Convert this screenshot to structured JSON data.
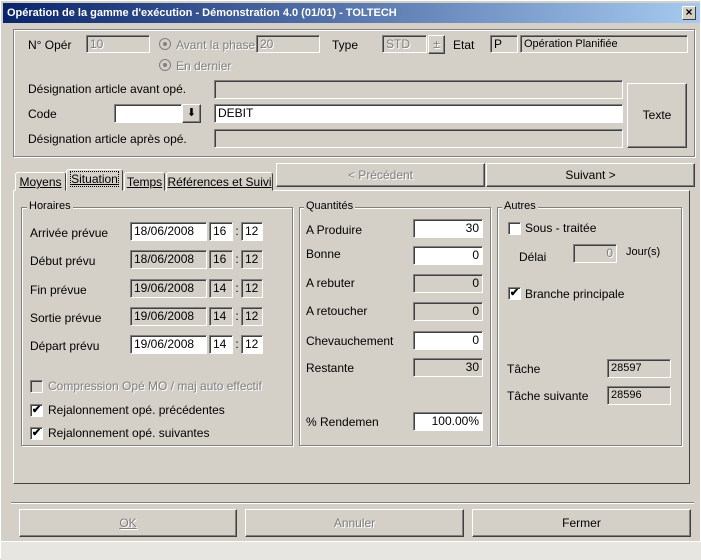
{
  "title": "Opération de la gamme d'exécution - Démonstration 4.0 (01/01) - TOLTECH",
  "header": {
    "no_oper_label": "N° Opér",
    "no_oper_value": "10",
    "radio_avant_label": "Avant la phase",
    "radio_avant_value": "20",
    "radio_dernier_label": "En dernier",
    "type_label": "Type",
    "type_value": "STD",
    "type_button": "±",
    "etat_label": "Etat",
    "etat_code": "P",
    "etat_value": "Opération Planifiée",
    "desig_avant_label": "Désignation article avant opé.",
    "desig_avant_value": "",
    "code_label": "Code",
    "code_value": "",
    "code_dropdown": "⬇",
    "code_desc": "DEBIT",
    "desig_apres_label": "Désignation article après opé.",
    "desig_apres_value": "",
    "texte_button": "Texte"
  },
  "tabs": [
    {
      "label": "Moyens",
      "accel": "M"
    },
    {
      "label": "Situation",
      "accel": "S"
    },
    {
      "label": "Temps",
      "accel": "T"
    },
    {
      "label": "Références et Suivi",
      "accel": "R"
    }
  ],
  "nav": {
    "prev": "< Précédent",
    "next": "Suivant >"
  },
  "horaires": {
    "legend": "Horaires",
    "rows": [
      {
        "label": "Arrivée prévue",
        "date": "18/06/2008",
        "hh": "16",
        "mm": "12",
        "editable": true
      },
      {
        "label": "Début prévu",
        "date": "18/06/2008",
        "hh": "16",
        "mm": "12",
        "editable": false
      },
      {
        "label": "Fin prévue",
        "date": "19/06/2008",
        "hh": "14",
        "mm": "12",
        "editable": false
      },
      {
        "label": "Sortie prévue",
        "date": "19/06/2008",
        "hh": "14",
        "mm": "12",
        "editable": false
      },
      {
        "label": "Départ prévu",
        "date": "19/06/2008",
        "hh": "14",
        "mm": "12",
        "editable": true
      }
    ],
    "colon": ":",
    "compression_label": "Compression Opé MO / maj auto effectif",
    "rejal_prec_label": "Rejalonnement opé. précédentes",
    "rejal_suiv_label": "Rejalonnement opé. suivantes",
    "check_mark": "✔"
  },
  "quantites": {
    "legend": "Quantités",
    "rows": [
      {
        "label": "A Produire",
        "value": "30",
        "editable": true
      },
      {
        "label": "Bonne",
        "value": "0",
        "editable": true
      },
      {
        "label": "A rebuter",
        "value": "0",
        "editable": false
      },
      {
        "label": "A retoucher",
        "value": "0",
        "editable": false
      },
      {
        "label": "Chevauchement",
        "value": "0",
        "editable": true
      },
      {
        "label": "Restante",
        "value": "30",
        "editable": false
      }
    ],
    "rendement_label": "% Rendemen",
    "rendement_value": "100.00%"
  },
  "autres": {
    "legend": "Autres",
    "sous_traitee_label": "Sous - traitée",
    "delai_label": "Délai",
    "delai_value": "0",
    "jours_label": "Jour(s)",
    "branche_label": "Branche principale",
    "tache_label": "Tâche",
    "tache_value": "28597",
    "tache_suiv_label": "Tâche suivante",
    "tache_suiv_value": "28596"
  },
  "footer": {
    "ok": "OK",
    "annuler": "Annuler",
    "fermer": "Fermer",
    "fermer_accel": "F"
  }
}
